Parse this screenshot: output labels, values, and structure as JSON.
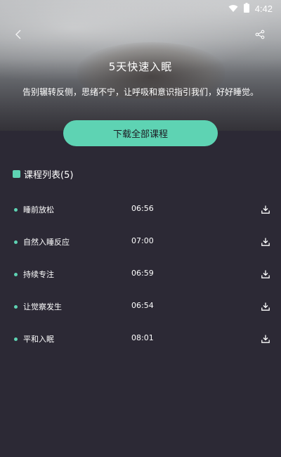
{
  "status_bar": {
    "time": "4:42"
  },
  "header": {
    "title": "5天快速入眠",
    "description": "告别辗转反侧，思绪不宁，让呼吸和意识指引我们，好好睡觉。"
  },
  "actions": {
    "download_all_label": "下载全部课程"
  },
  "course_list": {
    "heading": "课程列表(5)",
    "items": [
      {
        "name": "睡前放松",
        "duration": "06:56"
      },
      {
        "name": "自然入睡反应",
        "duration": "07:00"
      },
      {
        "name": "持续专注",
        "duration": "06:59"
      },
      {
        "name": "让觉察发生",
        "duration": "06:54"
      },
      {
        "name": "平和入眠",
        "duration": "08:01"
      }
    ]
  },
  "colors": {
    "accent": "#5ed3b3",
    "background": "#2c2935"
  },
  "icons": [
    "wifi-icon",
    "battery-icon",
    "back-icon",
    "share-icon",
    "download-icon"
  ]
}
